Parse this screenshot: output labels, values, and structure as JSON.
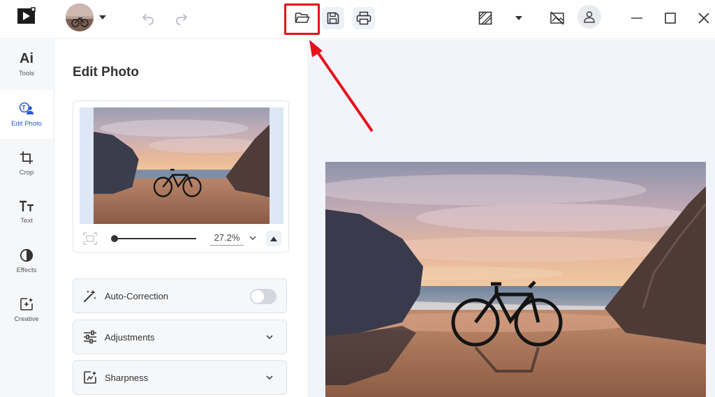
{
  "topbar": {
    "logo_icon": "play-logo-icon",
    "avatar_icon": "user-photo-avatar",
    "undo_icon": "undo-icon",
    "redo_icon": "redo-icon",
    "open_icon": "folder-open-icon",
    "save_icon": "save-icon",
    "print_icon": "print-icon",
    "compare_icon": "compare-icon",
    "no_image_icon": "image-off-icon",
    "account_icon": "user-icon",
    "minimize_icon": "minimize-icon",
    "maximize_icon": "maximize-icon",
    "close_icon": "close-icon",
    "highlight_color": "#e8101a"
  },
  "nav": {
    "items": [
      {
        "label": "Tools",
        "icon": "ai-icon"
      },
      {
        "label": "Edit Photo",
        "icon": "edit-photo-icon"
      },
      {
        "label": "Crop",
        "icon": "crop-icon"
      },
      {
        "label": "Text",
        "icon": "text-icon"
      },
      {
        "label": "Effects",
        "icon": "effects-icon"
      },
      {
        "label": "Creative",
        "icon": "creative-icon"
      }
    ],
    "ai_text": "Ai",
    "active_color": "#2a5bd7"
  },
  "panel": {
    "title": "Edit Photo",
    "zoom_value": "27.2%",
    "zoom_level": 0.272,
    "sections": [
      {
        "label": "Auto-Correction",
        "icon": "magic-wand-icon",
        "control": "toggle",
        "on": false
      },
      {
        "label": "Adjustments",
        "icon": "sliders-icon",
        "control": "chevron"
      },
      {
        "label": "Sharpness",
        "icon": "sharpness-icon",
        "control": "chevron"
      }
    ]
  }
}
